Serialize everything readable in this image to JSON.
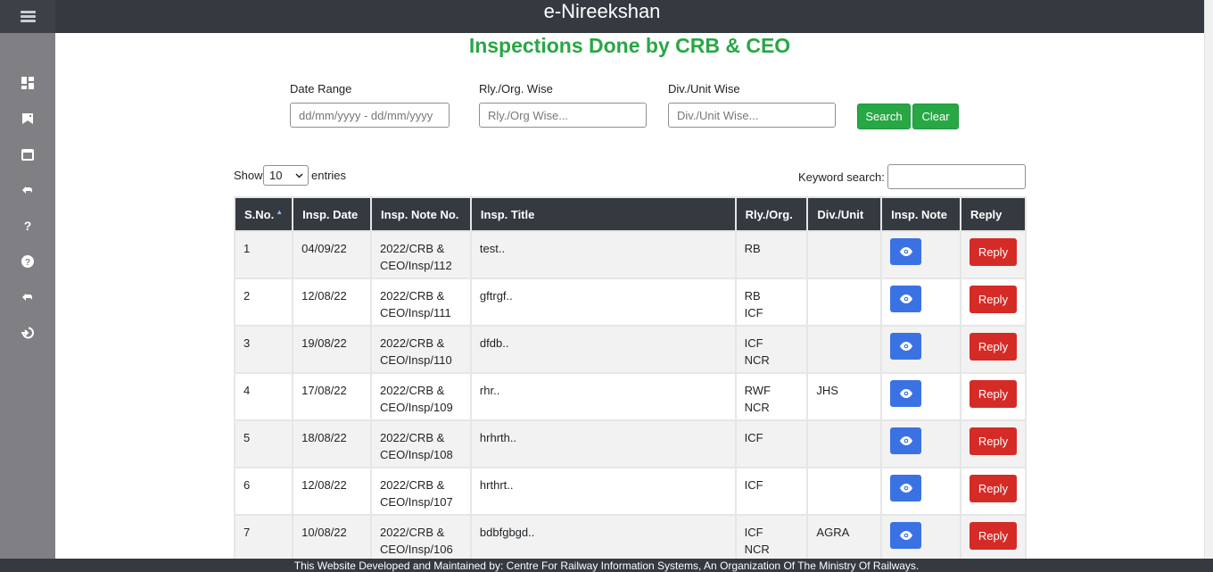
{
  "header": {
    "app_title": "e-Nireekshan"
  },
  "sidebar": {
    "items": [
      {
        "icon": "dashboard-icon"
      },
      {
        "icon": "bookmark-icon"
      },
      {
        "icon": "calendar-icon"
      },
      {
        "icon": "reply-icon"
      },
      {
        "icon": "help-icon"
      },
      {
        "icon": "question-circle-icon"
      },
      {
        "icon": "reply-icon"
      },
      {
        "icon": "logout-icon"
      }
    ]
  },
  "page": {
    "title": "Inspections Done by CRB & CEO"
  },
  "filters": {
    "date_range_label": "Date Range",
    "date_range_placeholder": "dd/mm/yyyy - dd/mm/yyyy",
    "rly_label": "Rly./Org. Wise",
    "rly_placeholder": "Rly./Org Wise...",
    "div_label": "Div./Unit Wise",
    "div_placeholder": "Div./Unit Wise...",
    "search_label": "Search",
    "clear_label": "Clear"
  },
  "table_controls": {
    "show_label": "Show",
    "page_size": "10",
    "entries_label": "entries",
    "keyword_label": "Keyword search:"
  },
  "table": {
    "headers": [
      "S.No.",
      "Insp. Date",
      "Insp. Note No.",
      "Insp. Title",
      "Rly./Org.",
      "Div./Unit",
      "Insp. Note",
      "Reply"
    ],
    "reply_label": "Reply",
    "rows": [
      {
        "sno": "1",
        "date": "04/09/22",
        "note_no_1": "2022/CRB &",
        "note_no_2": "CEO/Insp/112",
        "title": "test..",
        "rly_1": "RB",
        "rly_2": "",
        "div": ""
      },
      {
        "sno": "2",
        "date": "12/08/22",
        "note_no_1": "2022/CRB &",
        "note_no_2": "CEO/Insp/111",
        "title": "gftrgf..",
        "rly_1": "RB",
        "rly_2": "ICF",
        "div": ""
      },
      {
        "sno": "3",
        "date": "19/08/22",
        "note_no_1": "2022/CRB &",
        "note_no_2": "CEO/Insp/110",
        "title": "dfdb..",
        "rly_1": "ICF",
        "rly_2": "NCR",
        "div": ""
      },
      {
        "sno": "4",
        "date": "17/08/22",
        "note_no_1": "2022/CRB &",
        "note_no_2": "CEO/Insp/109",
        "title": "rhr..",
        "rly_1": "RWF",
        "rly_2": "NCR",
        "div": "JHS"
      },
      {
        "sno": "5",
        "date": "18/08/22",
        "note_no_1": "2022/CRB &",
        "note_no_2": "CEO/Insp/108",
        "title": "hrhrth..",
        "rly_1": "ICF",
        "rly_2": "",
        "div": ""
      },
      {
        "sno": "6",
        "date": "12/08/22",
        "note_no_1": "2022/CRB &",
        "note_no_2": "CEO/Insp/107",
        "title": "hrthrt..",
        "rly_1": "ICF",
        "rly_2": "",
        "div": ""
      },
      {
        "sno": "7",
        "date": "10/08/22",
        "note_no_1": "2022/CRB &",
        "note_no_2": "CEO/Insp/106",
        "title": "bdbfgbgd..",
        "rly_1": "ICF",
        "rly_2": "NCR",
        "div": "AGRA"
      }
    ]
  },
  "footer": {
    "text": "This Website Developed and Maintained by: Centre For Railway Information Systems, An Organization Of The Ministry Of Railways."
  },
  "colors": {
    "primary_green": "#28a745",
    "dark": "#343a40",
    "view_blue": "#3b72e3",
    "reply_red": "#d52b26",
    "sidebar_grey": "#7f7f84"
  }
}
